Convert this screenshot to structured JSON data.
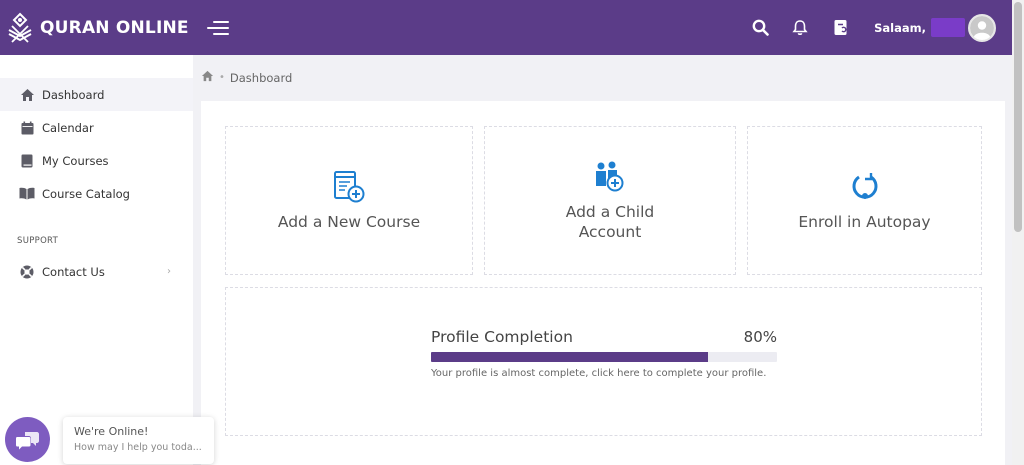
{
  "header": {
    "brand_name": "QURAN ONLINE",
    "greeting": "Salaam,",
    "icons": [
      "search-icon",
      "bell-icon",
      "book-icon"
    ]
  },
  "sidebar": {
    "items": [
      {
        "label": "Dashboard",
        "icon": "home-icon"
      },
      {
        "label": "Calendar",
        "icon": "calendar-icon"
      },
      {
        "label": "My Courses",
        "icon": "book-icon"
      },
      {
        "label": "Course Catalog",
        "icon": "open-book-icon"
      }
    ],
    "section_label": "SUPPORT",
    "support_items": [
      {
        "label": "Contact Us",
        "icon": "lifebuoy-icon"
      }
    ]
  },
  "breadcrumb": {
    "current": "Dashboard"
  },
  "cards": [
    {
      "title": "Add a New Course",
      "icon": "add-course-icon"
    },
    {
      "title": "Add a Child Account",
      "icon": "add-child-icon"
    },
    {
      "title": "Enroll in Autopay",
      "icon": "autopay-icon"
    }
  ],
  "profile": {
    "title": "Profile Completion",
    "percent_label": "80%",
    "percent": 80,
    "hint": "Your profile is almost complete, click here to complete your profile."
  },
  "chat": {
    "title": "We're Online!",
    "subtitle": "How may I help you toda..."
  },
  "colors": {
    "brand": "#5b3c88",
    "accent": "#1e7fd0",
    "chat": "#7e5cc0"
  }
}
